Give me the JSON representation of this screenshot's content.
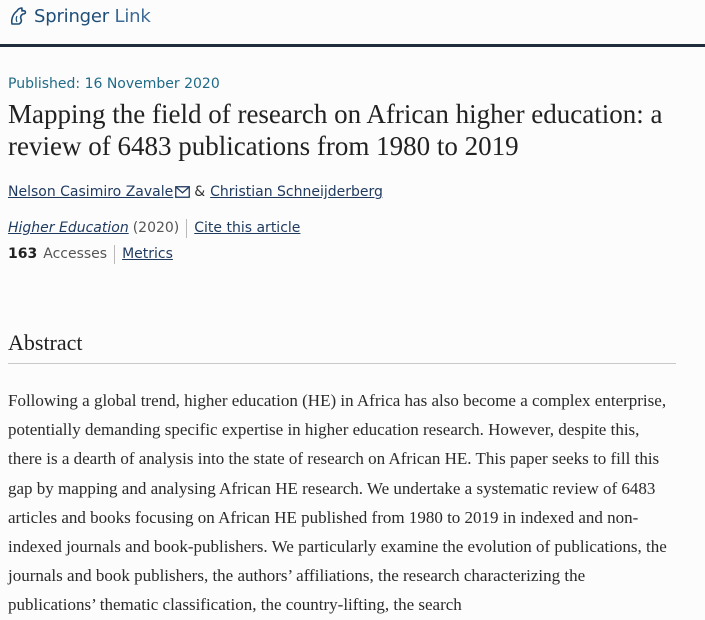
{
  "header": {
    "logo_word_bold": "Springer",
    "logo_word_light": "Link",
    "colors": {
      "brand": "#1f4e79",
      "bar": "#1f2d3d"
    }
  },
  "article": {
    "published": "Published: 16 November 2020",
    "title": "Mapping the field of research on African higher education: a review of 6483 publications from 1980 to 2019",
    "authors": [
      {
        "name": "Nelson Casimiro Zavale",
        "has_email_icon": true
      },
      {
        "name": "Christian Schneijderberg",
        "has_email_icon": false
      }
    ],
    "author_separator": "&",
    "journal": "Higher Education",
    "year": "(2020)",
    "cite_link": "Cite this article",
    "accesses_count": "163",
    "accesses_label": "Accesses",
    "metrics_link": "Metrics"
  },
  "abstract": {
    "heading": "Abstract",
    "text": "Following a global trend, higher education (HE) in Africa has also become a complex enterprise, potentially demanding specific expertise in higher education research. However, despite this, there is a dearth of analysis into the state of research on African HE. This paper seeks to fill this gap by mapping and analysing African HE research. We undertake a systematic review of 6483 articles and books focusing on African HE published from 1980 to 2019 in indexed and non-indexed journals and book-publishers. We particularly examine the evolution of publications, the journals and book publishers, the authors’ affiliations, the research characterizing the publications’ thematic classification, the country-lifting, the search"
  }
}
